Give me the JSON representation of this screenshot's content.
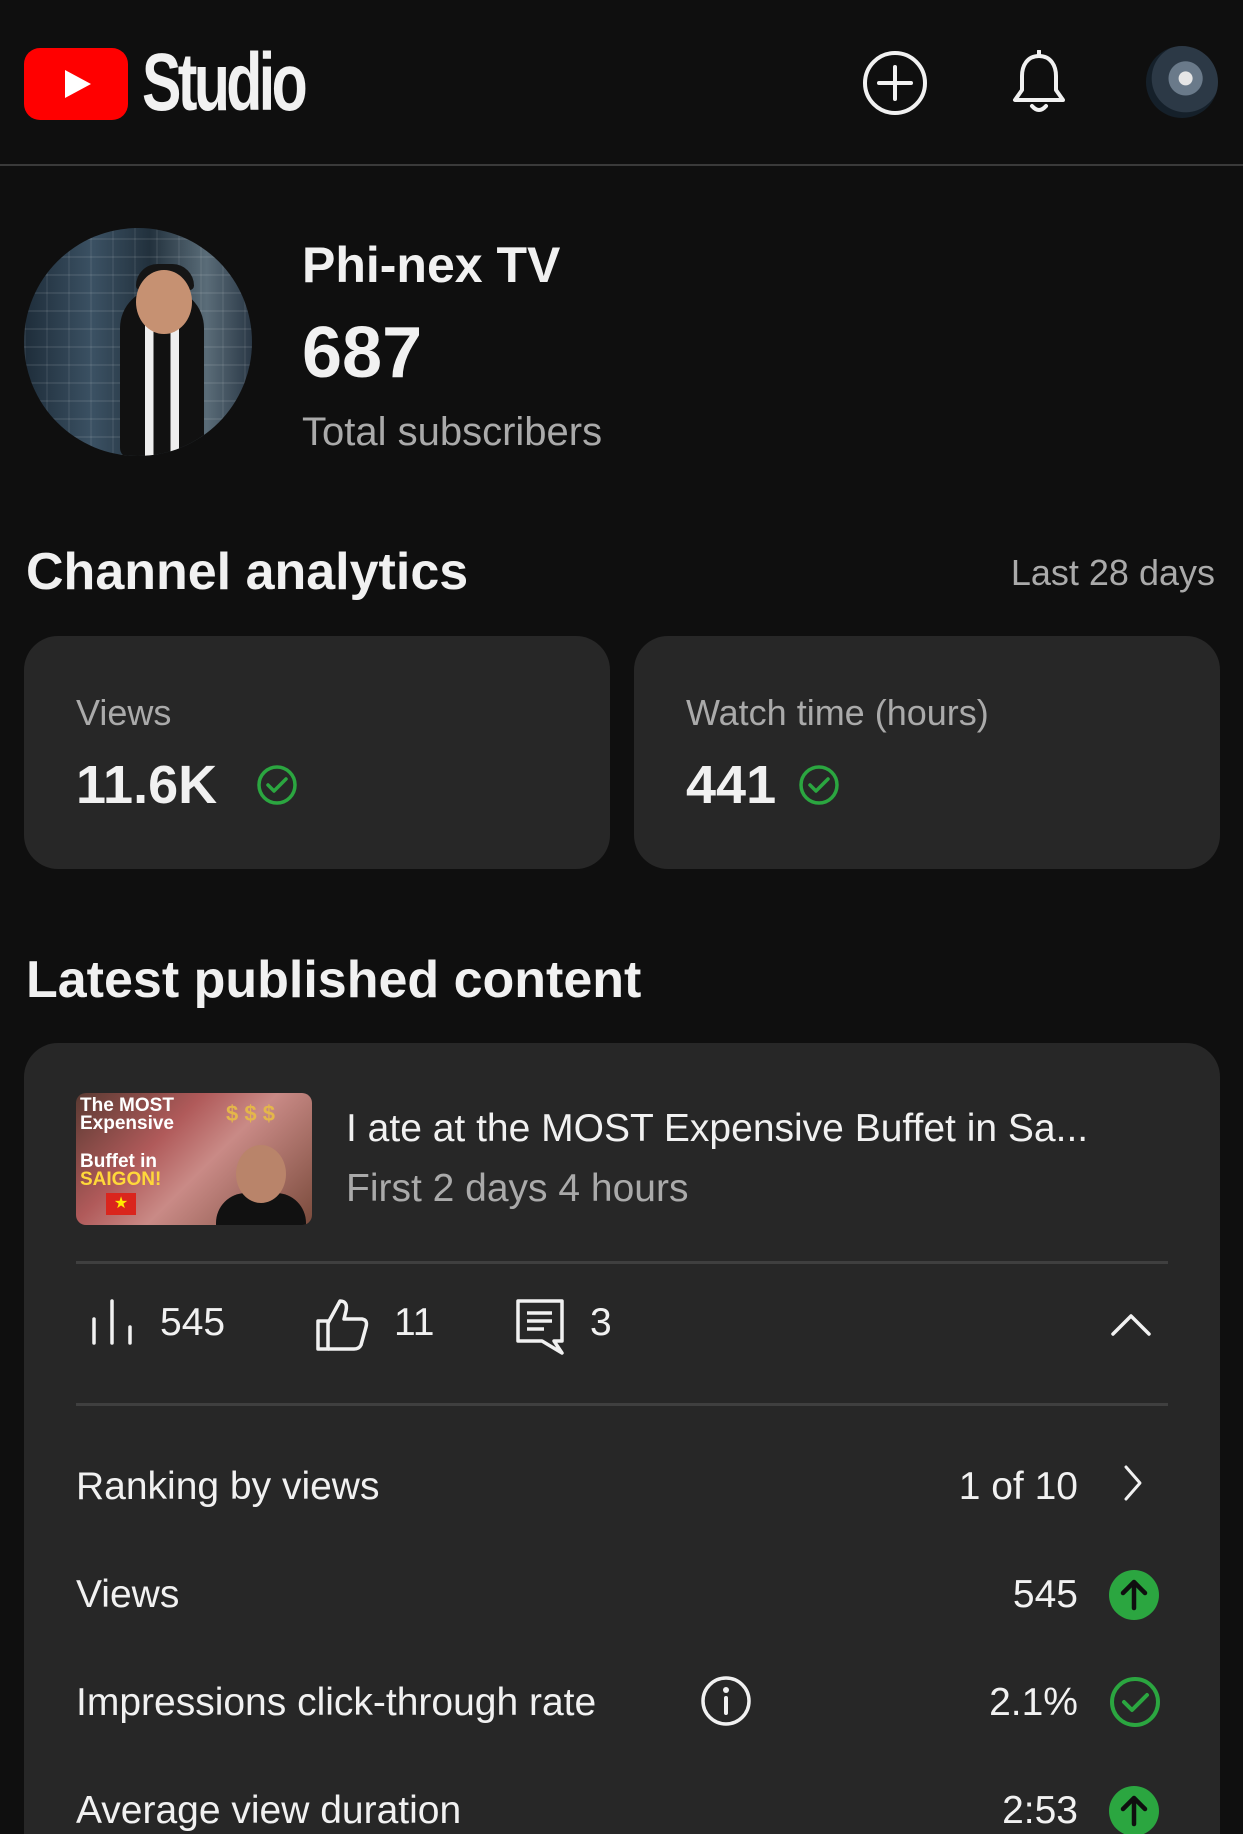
{
  "header": {
    "app_title": "Studio",
    "logo_icon": "youtube-play-icon",
    "create_icon": "plus-circle-icon",
    "notifications_icon": "bell-icon",
    "account_icon": "avatar"
  },
  "channel": {
    "name": "Phi-nex TV",
    "subscriber_count": "687",
    "subscriber_label": "Total subscribers"
  },
  "analytics": {
    "title": "Channel analytics",
    "period": "Last 28 days",
    "cards": [
      {
        "label": "Views",
        "value": "11.6K",
        "status_icon": "check-circle-icon"
      },
      {
        "label": "Watch time (hours)",
        "value": "441",
        "status_icon": "check-circle-icon"
      }
    ]
  },
  "latest": {
    "title": "Latest published content",
    "thumbnail": {
      "line1": "The MOST",
      "line2": "Expensive",
      "line3": "Buffet in",
      "line4": "SAIGON!",
      "dollars": "$ $ $"
    },
    "video_title": "I ate at the MOST Expensive Buffet in Sa...",
    "video_subtitle": "First 2 days 4 hours",
    "metrics": {
      "views": "545",
      "likes": "11",
      "comments": "3"
    },
    "rows": [
      {
        "label": "Ranking by views",
        "value": "1 of 10",
        "icon": "chevron-right-icon"
      },
      {
        "label": "Views",
        "value": "545",
        "icon": "arrow-up-circle-icon"
      },
      {
        "label": "Impressions click-through rate",
        "value": "2.1%",
        "icon": "check-circle-icon"
      },
      {
        "label": "Average view duration",
        "value": "2:53",
        "icon": "arrow-up-circle-icon"
      }
    ]
  },
  "colors": {
    "background": "#0f0f0f",
    "card": "#272727",
    "brand_red": "#ff0000",
    "success_green": "#2ba640",
    "secondary_text": "#aaaaaa"
  }
}
